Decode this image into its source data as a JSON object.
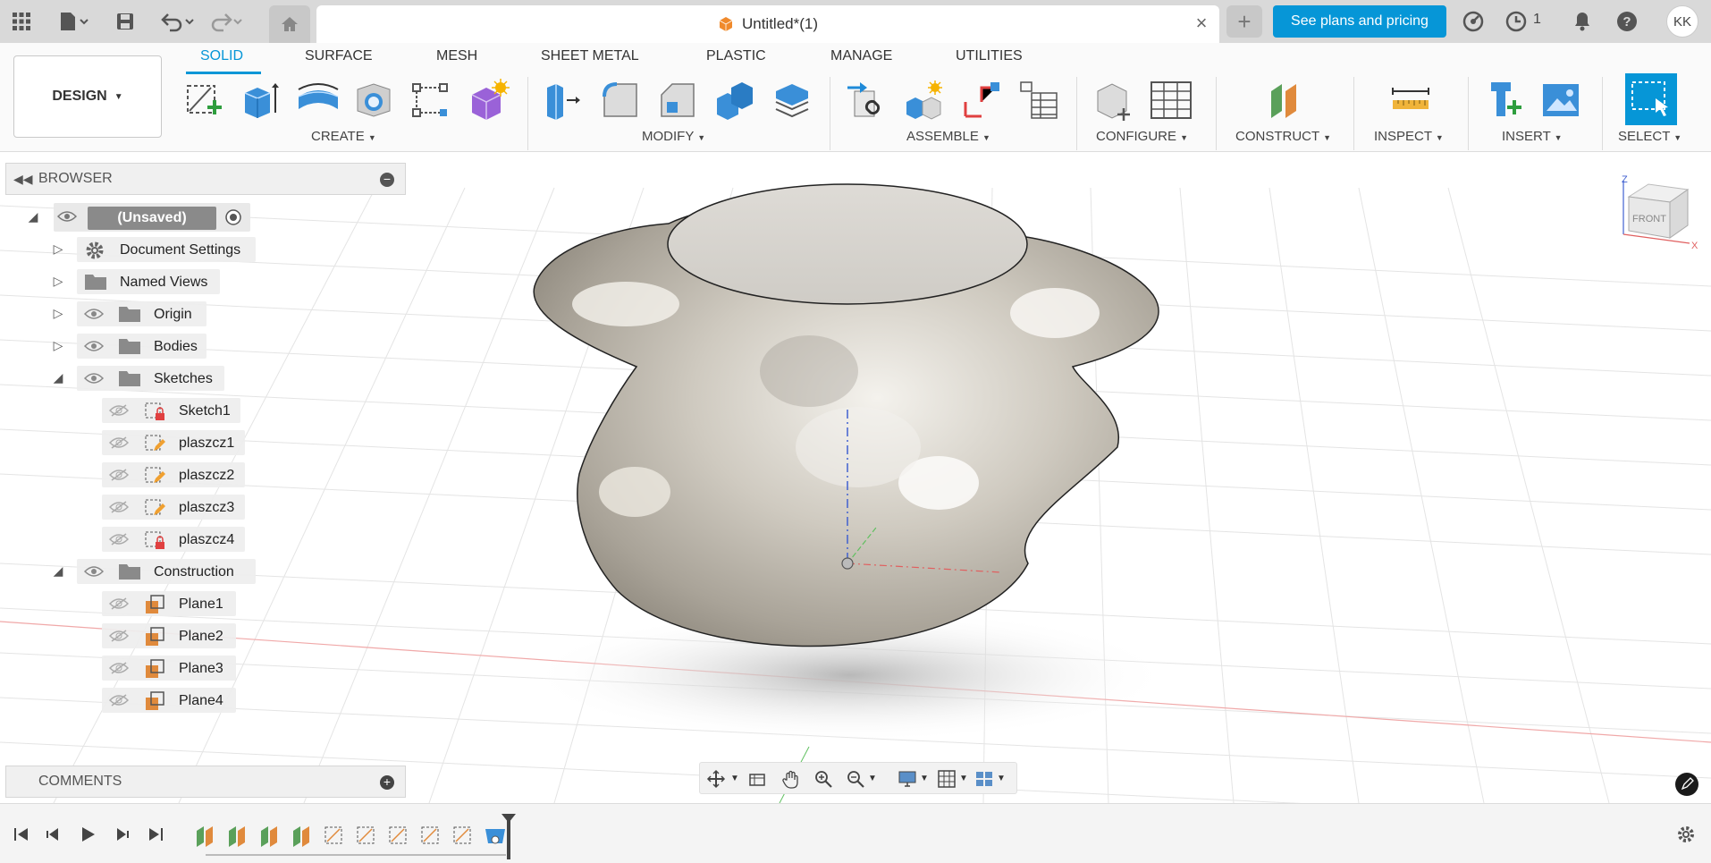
{
  "topbar": {
    "doc_title": "Untitled*(1)",
    "plans_button": "See plans and pricing",
    "jobs_count": "1",
    "user_initials": "KK",
    "close_glyph": "×",
    "new_tab_glyph": "+"
  },
  "ribbon": {
    "workspace": "DESIGN",
    "tabs": [
      "SOLID",
      "SURFACE",
      "MESH",
      "SHEET METAL",
      "PLASTIC",
      "MANAGE",
      "UTILITIES"
    ],
    "active_tab": "SOLID",
    "groups": [
      "CREATE",
      "MODIFY",
      "ASSEMBLE",
      "CONFIGURE",
      "CONSTRUCT",
      "INSPECT",
      "INSERT",
      "SELECT"
    ]
  },
  "browser": {
    "title": "BROWSER",
    "root": "(Unsaved)",
    "items": [
      {
        "label": "Document Settings",
        "icon": "gear-icon"
      },
      {
        "label": "Named Views",
        "icon": "folder-icon"
      },
      {
        "label": "Origin",
        "icon": "folder-icon"
      },
      {
        "label": "Bodies",
        "icon": "folder-icon"
      },
      {
        "label": "Sketches",
        "icon": "folder-icon"
      },
      {
        "label": "Sketch1",
        "icon": "sketch-locked-icon"
      },
      {
        "label": "plaszcz1",
        "icon": "sketch-edit-icon"
      },
      {
        "label": "plaszcz2",
        "icon": "sketch-edit-icon"
      },
      {
        "label": "plaszcz3",
        "icon": "sketch-edit-icon"
      },
      {
        "label": "plaszcz4",
        "icon": "sketch-locked-icon"
      },
      {
        "label": "Construction",
        "icon": "folder-icon"
      },
      {
        "label": "Plane1",
        "icon": "plane-icon"
      },
      {
        "label": "Plane2",
        "icon": "plane-icon"
      },
      {
        "label": "Plane3",
        "icon": "plane-icon"
      },
      {
        "label": "Plane4",
        "icon": "plane-icon"
      }
    ]
  },
  "comments": {
    "title": "COMMENTS"
  },
  "viewcube": {
    "face": "FRONT",
    "axis_z": "Z",
    "axis_x": "X"
  },
  "colors": {
    "accent": "#0696d7",
    "body": "#c9c5bc",
    "axis_red": "#e06060",
    "axis_green": "#60c060",
    "axis_blue": "#4060d0"
  }
}
